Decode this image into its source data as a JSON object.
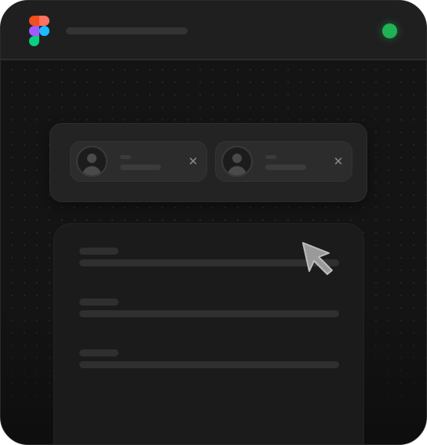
{
  "window": {
    "title_text": "",
    "status": "online"
  },
  "titlebar": {
    "logo": "figma-logo-icon",
    "status_dot_color": "#1fb356"
  },
  "chip_panel": {
    "chips": [
      {
        "avatar_icon": "user-avatar-icon",
        "close_icon": "close-icon",
        "close_glyph": "✕"
      },
      {
        "avatar_icon": "user-avatar-icon",
        "close_icon": "close-icon",
        "close_glyph": "✕"
      }
    ]
  },
  "form": {
    "fields": [
      {
        "label": "",
        "value": ""
      },
      {
        "label": "",
        "value": ""
      },
      {
        "label": "",
        "value": ""
      }
    ]
  },
  "cursor": {
    "icon": "pointer-cursor-icon"
  },
  "colors": {
    "window_bg": "#121212",
    "titlebar_bg": "#1f1f1f",
    "panel_bg": "#232323",
    "chip_bg": "#2c2c2c",
    "card_bg": "#1b1b1b",
    "accent_green": "#1fb356"
  }
}
